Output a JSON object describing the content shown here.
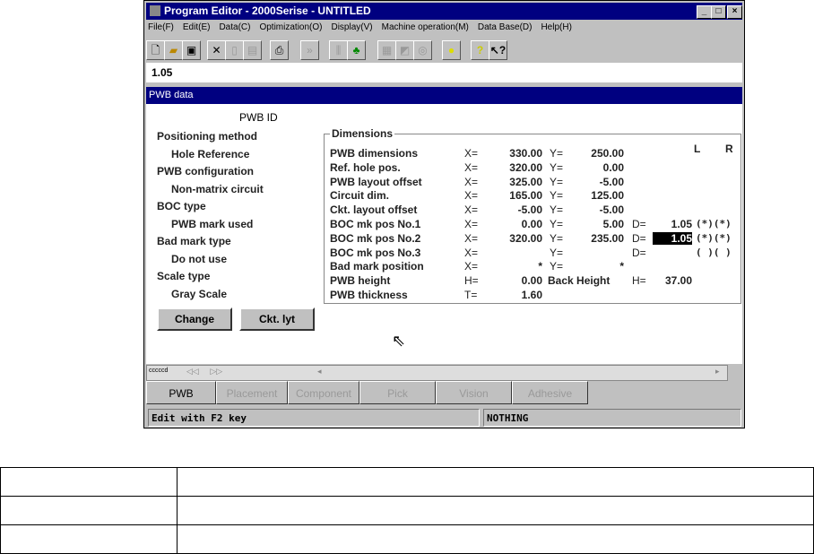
{
  "window": {
    "title": "Program Editor - 2000Serise - UNTITLED",
    "min": "_",
    "max": "□",
    "close": "×"
  },
  "menu": [
    "File(F)",
    "Edit(E)",
    "Data(C)",
    "Optimization(O)",
    "Display(V)",
    "Machine operation(M)",
    "Data Base(D)",
    "Help(H)"
  ],
  "input_value": "1.05",
  "panel": {
    "title": "PWB data",
    "pwb_id": "PWB ID",
    "left": [
      {
        "label": "Positioning method",
        "value": "Hole Reference"
      },
      {
        "label": "PWB configuration",
        "value": "Non-matrix circuit"
      },
      {
        "label": "BOC type",
        "value": "PWB mark used"
      },
      {
        "label": "Bad mark type",
        "value": "Do not use"
      },
      {
        "label": "Scale type",
        "value": "Gray Scale"
      }
    ],
    "change": "Change",
    "ckt": "Ckt. lyt"
  },
  "dims": {
    "title": "Dimensions",
    "L": "L",
    "R": "R",
    "back_height": "Back Height",
    "bh_key": "H=",
    "bh_val": "37.00",
    "rows": [
      {
        "label": "PWB dimensions",
        "xk": "X=",
        "x": "330.00",
        "yk": "Y=",
        "y": "250.00",
        "dk": "",
        "d": "",
        "lr": ""
      },
      {
        "label": "Ref. hole pos.",
        "xk": "X=",
        "x": "320.00",
        "yk": "Y=",
        "y": "0.00",
        "dk": "",
        "d": "",
        "lr": ""
      },
      {
        "label": "PWB layout offset",
        "xk": "X=",
        "x": "325.00",
        "yk": "Y=",
        "y": "-5.00",
        "dk": "",
        "d": "",
        "lr": ""
      },
      {
        "label": "Circuit dim.",
        "xk": "X=",
        "x": "165.00",
        "yk": "Y=",
        "y": "125.00",
        "dk": "",
        "d": "",
        "lr": ""
      },
      {
        "label": "Ckt. layout offset",
        "xk": "X=",
        "x": "-5.00",
        "yk": "Y=",
        "y": "-5.00",
        "dk": "",
        "d": "",
        "lr": ""
      },
      {
        "label": "BOC mk pos No.1",
        "xk": "X=",
        "x": "0.00",
        "yk": "Y=",
        "y": "5.00",
        "dk": "D=",
        "d": "1.05",
        "lr": "(*)(*)"
      },
      {
        "label": "BOC mk pos No.2",
        "xk": "X=",
        "x": "320.00",
        "yk": "Y=",
        "y": "235.00",
        "dk": "D=",
        "d": "1.05",
        "lr": "(*)(*)"
      },
      {
        "label": "BOC mk pos No.3",
        "xk": "X=",
        "x": "",
        "yk": "Y=",
        "y": "",
        "dk": "D=",
        "d": "",
        "lr": "( )( )"
      },
      {
        "label": "Bad mark position",
        "xk": "X=",
        "x": "*",
        "yk": "Y=",
        "y": "*",
        "dk": "",
        "d": "",
        "lr": ""
      },
      {
        "label": "PWB height",
        "xk": "H=",
        "x": "0.00",
        "yk": "",
        "y": "",
        "dk": "",
        "d": "",
        "lr": ""
      },
      {
        "label": "PWB thickness",
        "xk": "T=",
        "x": "1.60",
        "yk": "",
        "y": "",
        "dk": "",
        "d": "",
        "lr": ""
      }
    ]
  },
  "scroll_label": "cccccd",
  "tabs": [
    "PWB",
    "Placement",
    "Component",
    "Pick",
    "Vision",
    "Adhesive"
  ],
  "status": {
    "left": "Edit with F2 key",
    "right": "NOTHING"
  }
}
